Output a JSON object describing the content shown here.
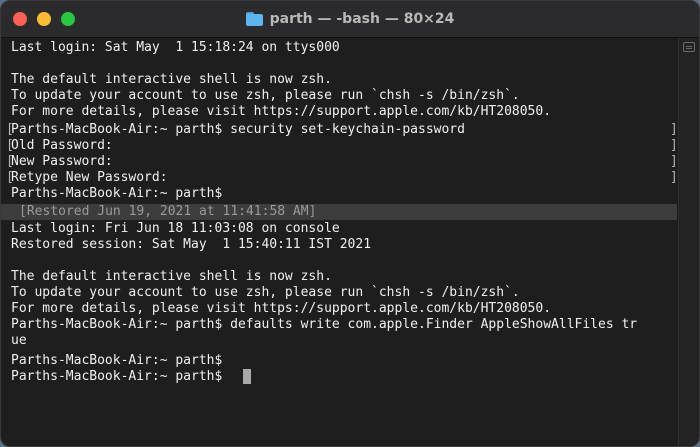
{
  "window": {
    "title": "parth — -bash — 80×24"
  },
  "terminal": {
    "lines": [
      "Last login: Sat May  1 15:18:24 on ttys000",
      "",
      "The default interactive shell is now zsh.",
      "To update your account to use zsh, please run `chsh -s /bin/zsh`.",
      "For more details, please visit https://support.apple.com/kb/HT208050.",
      "Parths-MacBook-Air:~ parth$ security set-keychain-password",
      "Old Password:",
      "New Password:",
      "Retype New Password:",
      "Parths-MacBook-Air:~ parth$",
      "Last login: Fri Jun 18 11:03:08 on console",
      "Restored session: Sat May  1 15:40:11 IST 2021",
      "",
      "The default interactive shell is now zsh.",
      "To update your account to use zsh, please run `chsh -s /bin/zsh`.",
      "For more details, please visit https://support.apple.com/kb/HT208050.",
      "Parths-MacBook-Air:~ parth$ defaults write com.apple.Finder AppleShowAllFiles tr",
      "ue",
      "Parths-MacBook-Air:~ parth$",
      "Parths-MacBook-Air:~ parth$"
    ],
    "restored_marker": "[Restored Jun 19, 2021 at 11:41:58 AM]"
  },
  "colors": {
    "close": "#fe5f57",
    "minimize": "#febc2e",
    "zoom": "#28c840",
    "background": "#1e1e1e",
    "text": "#f0f0f0"
  },
  "icons": {
    "title_icon": "folder-icon"
  }
}
